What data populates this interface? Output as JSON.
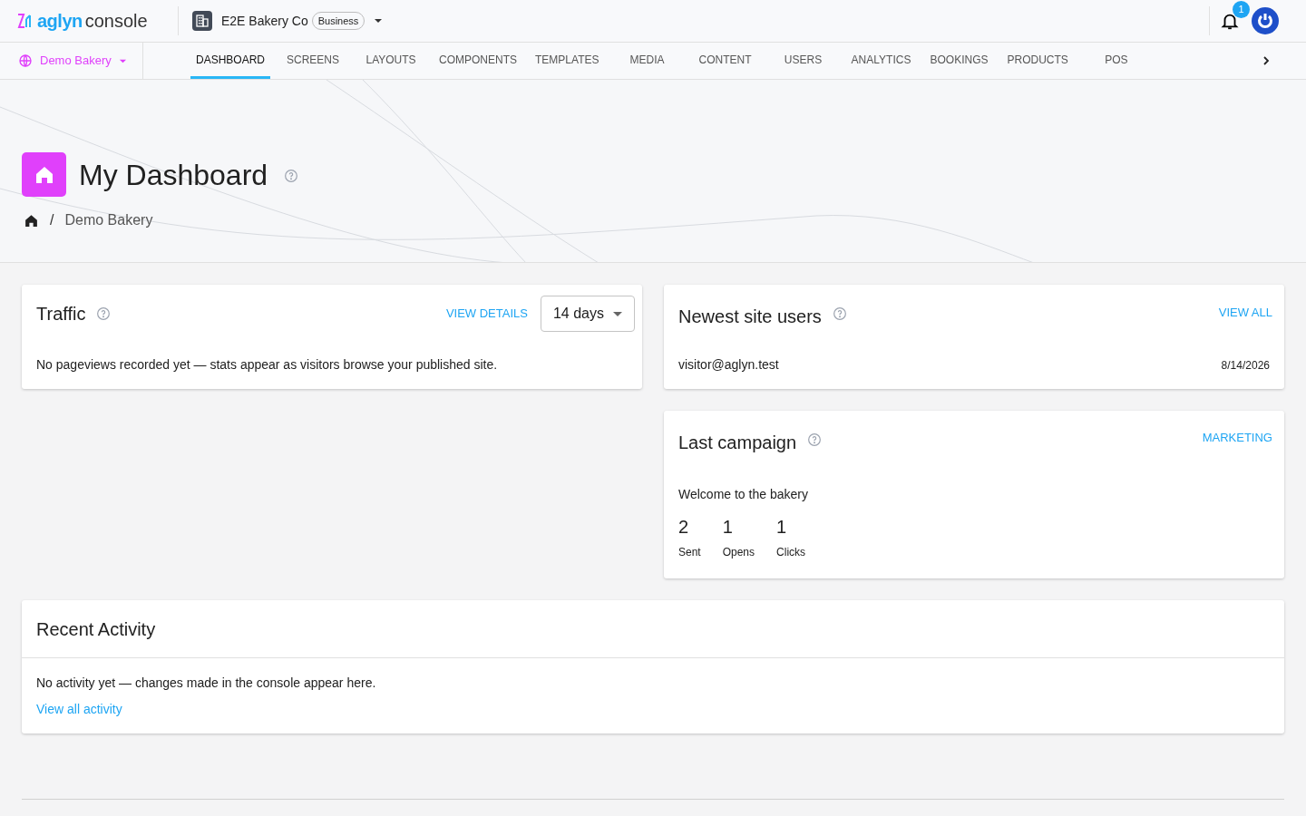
{
  "header": {
    "logo_brand": "aglyn",
    "logo_product": "console",
    "org_name": "E2E Bakery Co",
    "org_plan": "Business",
    "notification_count": "1"
  },
  "site_selector": {
    "label": "Demo Bakery"
  },
  "tabs": [
    {
      "label": "DASHBOARD",
      "selected": true
    },
    {
      "label": "SCREENS",
      "selected": false
    },
    {
      "label": "LAYOUTS",
      "selected": false
    },
    {
      "label": "COMPONENTS",
      "selected": false
    },
    {
      "label": "TEMPLATES",
      "selected": false
    },
    {
      "label": "MEDIA",
      "selected": false
    },
    {
      "label": "CONTENT",
      "selected": false
    },
    {
      "label": "USERS",
      "selected": false
    },
    {
      "label": "ANALYTICS",
      "selected": false
    },
    {
      "label": "BOOKINGS",
      "selected": false
    },
    {
      "label": "PRODUCTS",
      "selected": false
    },
    {
      "label": "POS",
      "selected": false
    }
  ],
  "page": {
    "title": "My Dashboard",
    "breadcrumb_separator": "/",
    "breadcrumb": [
      "Demo Bakery"
    ]
  },
  "traffic": {
    "title": "Traffic",
    "link": "VIEW DETAILS",
    "range": "14 days",
    "message": "No pageviews recorded yet — stats appear as visitors browse your published site."
  },
  "newest_users": {
    "title": "Newest site users",
    "link": "VIEW ALL",
    "rows": [
      {
        "email": "visitor@aglyn.test",
        "date": "8/14/2026"
      }
    ]
  },
  "last_campaign": {
    "title": "Last campaign",
    "link": "MARKETING",
    "name": "Welcome to the bakery",
    "stats": [
      {
        "value": "2",
        "label": "Sent"
      },
      {
        "value": "1",
        "label": "Opens"
      },
      {
        "value": "1",
        "label": "Clicks"
      }
    ]
  },
  "recent_activity": {
    "title": "Recent Activity",
    "message": "No activity yet — changes made in the console appear here.",
    "link": "View all activity"
  }
}
